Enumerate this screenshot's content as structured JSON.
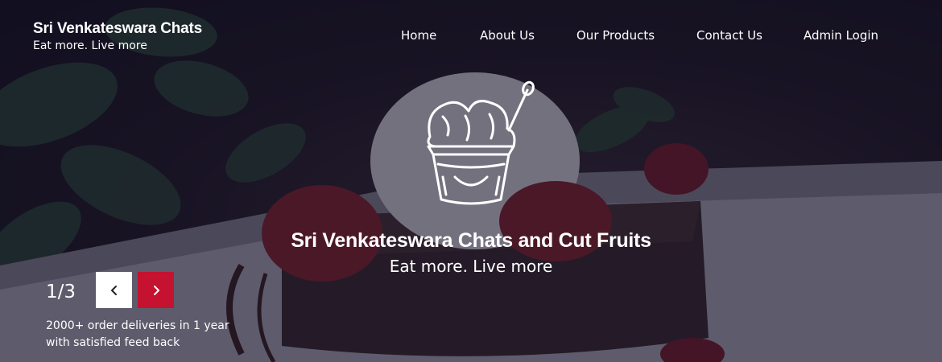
{
  "brand": {
    "name": "Sri Venkateswara Chats",
    "tagline": "Eat more. Live more"
  },
  "nav": {
    "items": [
      {
        "label": "Home"
      },
      {
        "label": "About Us"
      },
      {
        "label": "Our Products"
      },
      {
        "label": "Contact Us"
      },
      {
        "label": "Admin Login"
      }
    ]
  },
  "hero": {
    "logo_icon": "ice-cream-cup-icon",
    "title": "Sri Venkateswara Chats and Cut Fruits",
    "subtitle": "Eat more. Live more"
  },
  "slider": {
    "counter": "1/3",
    "prev_icon": "chevron-left-icon",
    "next_icon": "chevron-right-icon",
    "stat_line1": "2000+ order deliveries in 1 year",
    "stat_line2": "with satisfied feed back"
  },
  "colors": {
    "accent": "#c41230",
    "overlay": "#14122d",
    "text": "#ffffff"
  }
}
